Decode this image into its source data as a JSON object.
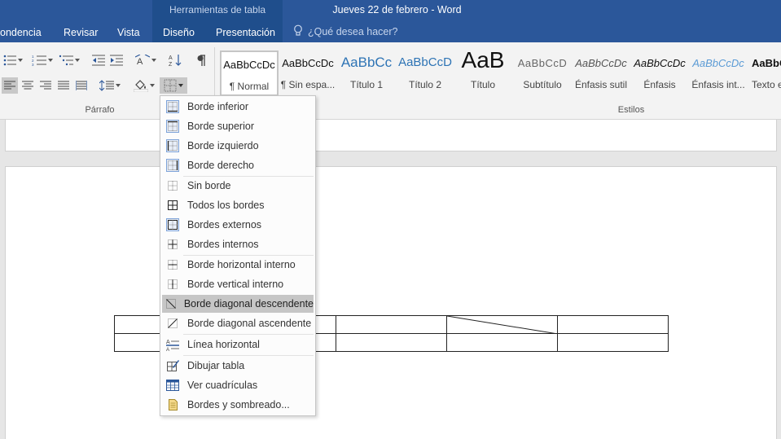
{
  "titlebar": {
    "context_label": "Herramientas de tabla",
    "window_title": "Jueves 22 de febrero - Word",
    "tabs": [
      "ondencia",
      "Revisar",
      "Vista",
      "Diseño",
      "Presentación"
    ],
    "tellme": "¿Qué desea hacer?"
  },
  "ribbon": {
    "groups": {
      "parrafo": "Párrafo",
      "estilos": "Estilos"
    },
    "styles": [
      {
        "sample": "AaBbCcDc",
        "name": "¶ Normal"
      },
      {
        "sample": "AaBbCcDc",
        "name": "¶ Sin espa..."
      },
      {
        "sample": "AaBbCc",
        "name": "Título 1"
      },
      {
        "sample": "AaBbCcD",
        "name": "Título 2"
      },
      {
        "sample": "AaB",
        "name": "Título"
      },
      {
        "sample": "AaBbCcD",
        "name": "Subtítulo"
      },
      {
        "sample": "AaBbCcDc",
        "name": "Énfasis sutil"
      },
      {
        "sample": "AaBbCcDc",
        "name": "Énfasis"
      },
      {
        "sample": "AaBbCcDc",
        "name": "Énfasis int..."
      },
      {
        "sample": "AaBbC",
        "name": "Texto e"
      }
    ]
  },
  "menu": {
    "items": [
      {
        "label": "Borde inferior",
        "icon": "border-bottom-icon"
      },
      {
        "label": "Borde superior",
        "icon": "border-top-icon"
      },
      {
        "label": "Borde izquierdo",
        "icon": "border-left-icon"
      },
      {
        "label": "Borde derecho",
        "icon": "border-right-icon"
      },
      {
        "label": "Sin borde",
        "icon": "no-border-icon"
      },
      {
        "label": "Todos los bordes",
        "icon": "all-borders-icon"
      },
      {
        "label": "Bordes externos",
        "icon": "outside-borders-icon"
      },
      {
        "label": "Bordes internos",
        "icon": "inside-borders-icon"
      },
      {
        "label": "Borde horizontal interno",
        "icon": "inside-horizontal-border-icon"
      },
      {
        "label": "Borde vertical interno",
        "icon": "inside-vertical-border-icon"
      },
      {
        "label": "Borde diagonal descendente",
        "icon": "diagonal-down-border-icon"
      },
      {
        "label": "Borde diagonal ascendente",
        "icon": "diagonal-up-border-icon"
      },
      {
        "label": "Línea horizontal",
        "icon": "horizontal-line-icon"
      },
      {
        "label": "Dibujar tabla",
        "icon": "draw-table-icon"
      },
      {
        "label": "Ver cuadrículas",
        "icon": "view-gridlines-icon"
      },
      {
        "label": "Bordes y sombreado...",
        "icon": "borders-shading-icon"
      }
    ],
    "highlighted_index": 10
  },
  "colors": {
    "titlebar": "#2b579a",
    "context_band": "#1f4e8c",
    "ribbon": "#f3f3f3",
    "menu_highlight": "#c6c6c6",
    "heading_blue": "#2e74b5"
  }
}
